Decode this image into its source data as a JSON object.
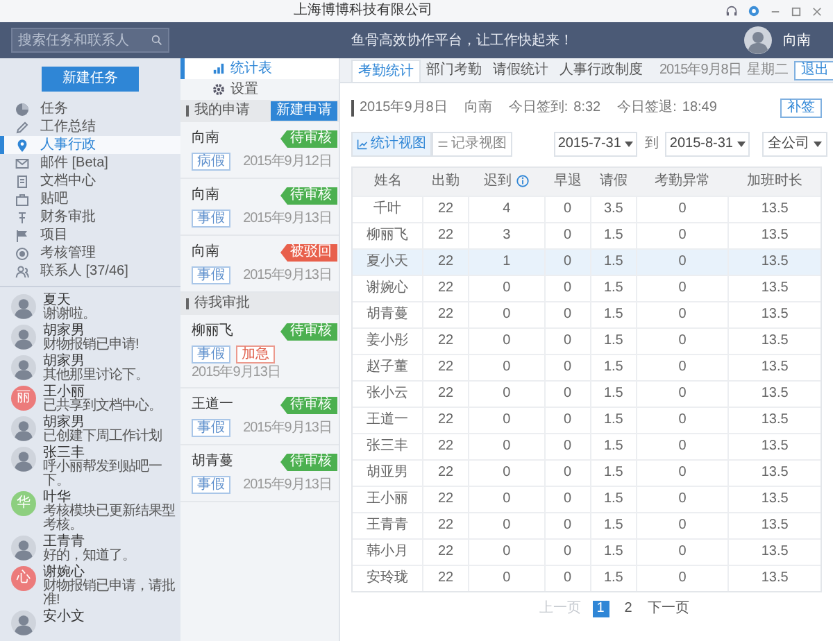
{
  "window": {
    "title": "上海博博科技有限公司"
  },
  "header": {
    "search": {
      "placeholder": "搜索任务和联系人"
    },
    "slogan": "鱼骨高效协作平台，让工作快起来！",
    "user": "向南"
  },
  "sidebar": {
    "new_task_button": "新建任务",
    "items": [
      {
        "label": "任务",
        "selected": false
      },
      {
        "label": "工作总结",
        "selected": false
      },
      {
        "label": "人事行政",
        "selected": true
      },
      {
        "label": "邮件 [Beta]",
        "selected": false
      },
      {
        "label": "文档中心",
        "selected": false
      },
      {
        "label": "贴吧",
        "selected": false
      },
      {
        "label": "财务审批",
        "selected": false
      },
      {
        "label": "项目",
        "selected": false
      },
      {
        "label": "考核管理",
        "selected": false
      },
      {
        "label": "联系人 [37/46]",
        "selected": false
      }
    ]
  },
  "contacts": [
    {
      "name": "夏天",
      "message": "谢谢啦。",
      "kind": "photo"
    },
    {
      "name": "胡家男",
      "message": "财物报销已申请!",
      "kind": "photo"
    },
    {
      "name": "胡家男",
      "message": "其他那里讨论下。",
      "kind": "photo"
    },
    {
      "name": "王小丽",
      "message": "已共享到文档中心。",
      "kind": "initial",
      "initial": "丽",
      "color": "#ec7b7b"
    },
    {
      "name": "胡家男",
      "message": "已创建下周工作计划",
      "kind": "photo"
    },
    {
      "name": "张三丰",
      "message": "呼小丽帮发到贴吧一下。",
      "kind": "photo"
    },
    {
      "name": "叶华",
      "message": "考核模块已更新结果型考核。",
      "kind": "initial",
      "initial": "华",
      "color": "#8dcf7f"
    },
    {
      "name": "王青青",
      "message": "好的，知道了。",
      "kind": "photo"
    },
    {
      "name": "谢婉心",
      "message": "财物报销已申请，请批准!",
      "kind": "initial",
      "initial": "心",
      "color": "#ec7b7b"
    },
    {
      "name": "安小文",
      "kind": "photo"
    }
  ],
  "module_tabs": [
    {
      "label": "统计表",
      "selected": true
    },
    {
      "label": "设置",
      "selected": false
    }
  ],
  "sections": [
    {
      "title": "我的申请",
      "button": "新建申请",
      "requests": [
        {
          "name": "向南",
          "tags": [
            {
              "label": "病假",
              "kind": "normal"
            }
          ],
          "date": "2015年9月12日",
          "status": {
            "label": "待审核",
            "kind": "pending"
          }
        },
        {
          "name": "向南",
          "tags": [
            {
              "label": "事假",
              "kind": "normal"
            }
          ],
          "date": "2015年9月13日",
          "status": {
            "label": "待审核",
            "kind": "pending"
          }
        },
        {
          "name": "向南",
          "tags": [
            {
              "label": "事假",
              "kind": "normal"
            }
          ],
          "date": "2015年9月13日",
          "status": {
            "label": "被驳回",
            "kind": "rejected"
          }
        }
      ]
    },
    {
      "title": "待我审批",
      "requests": [
        {
          "name": "柳丽飞",
          "tags": [
            {
              "label": "事假",
              "kind": "normal"
            },
            {
              "label": "加急",
              "kind": "urgent"
            }
          ],
          "date": "2015年9月13日",
          "status": {
            "label": "待审核",
            "kind": "pending"
          }
        },
        {
          "name": "王道一",
          "tags": [
            {
              "label": "事假",
              "kind": "normal"
            }
          ],
          "date": "2015年9月13日",
          "status": {
            "label": "待审核",
            "kind": "pending"
          }
        },
        {
          "name": "胡青蔓",
          "tags": [
            {
              "label": "事假",
              "kind": "normal"
            }
          ],
          "date": "2015年9月13日",
          "status": {
            "label": "待审核",
            "kind": "pending"
          }
        }
      ]
    }
  ],
  "tabs": [
    {
      "label": "考勤统计",
      "selected": true
    },
    {
      "label": "部门考勤",
      "selected": false
    },
    {
      "label": "请假统计",
      "selected": false
    },
    {
      "label": "人事行政制度",
      "selected": false
    }
  ],
  "today": {
    "date": "2015年9月8日",
    "weekday": "星期二"
  },
  "logout_button": "退出",
  "attendance": {
    "date": "2015年9月8日",
    "name": "向南",
    "checkin_label": "今日签到:",
    "checkin": "8:32",
    "checkout_label": "今日签退:",
    "checkout": "18:49",
    "button": "补签"
  },
  "view_toggle": [
    {
      "label": "统计视图",
      "selected": true
    },
    {
      "label": "记录视图",
      "selected": false
    }
  ],
  "range": {
    "from": "2015-7-31",
    "to_label": "到",
    "to": "2015-8-31"
  },
  "scope": "全公司",
  "table": {
    "columns": [
      {
        "label": "姓名",
        "info": false
      },
      {
        "label": "出勤",
        "info": false
      },
      {
        "label": "迟到",
        "info": true
      },
      {
        "label": "早退",
        "info": false
      },
      {
        "label": "请假",
        "info": false
      },
      {
        "label": "考勤异常",
        "info": false
      },
      {
        "label": "加班时长",
        "info": false
      }
    ],
    "rows": [
      {
        "cells": [
          "千叶",
          "22",
          "4",
          "0",
          "3.5",
          "0",
          "13.5"
        ],
        "selected": false
      },
      {
        "cells": [
          "柳丽飞",
          "22",
          "3",
          "0",
          "1.5",
          "0",
          "13.5"
        ],
        "selected": false
      },
      {
        "cells": [
          "夏小天",
          "22",
          "1",
          "0",
          "1.5",
          "0",
          "13.5"
        ],
        "selected": true
      },
      {
        "cells": [
          "谢婉心",
          "22",
          "0",
          "0",
          "1.5",
          "0",
          "13.5"
        ],
        "selected": false
      },
      {
        "cells": [
          "胡青蔓",
          "22",
          "0",
          "0",
          "1.5",
          "0",
          "13.5"
        ],
        "selected": false
      },
      {
        "cells": [
          "姜小彤",
          "22",
          "0",
          "0",
          "1.5",
          "0",
          "13.5"
        ],
        "selected": false
      },
      {
        "cells": [
          "赵子董",
          "22",
          "0",
          "0",
          "1.5",
          "0",
          "13.5"
        ],
        "selected": false
      },
      {
        "cells": [
          "张小云",
          "22",
          "0",
          "0",
          "1.5",
          "0",
          "13.5"
        ],
        "selected": false
      },
      {
        "cells": [
          "王道一",
          "22",
          "0",
          "0",
          "1.5",
          "0",
          "13.5"
        ],
        "selected": false
      },
      {
        "cells": [
          "张三丰",
          "22",
          "0",
          "0",
          "1.5",
          "0",
          "13.5"
        ],
        "selected": false
      },
      {
        "cells": [
          "胡亚男",
          "22",
          "0",
          "0",
          "1.5",
          "0",
          "13.5"
        ],
        "selected": false
      },
      {
        "cells": [
          "王小丽",
          "22",
          "0",
          "0",
          "1.5",
          "0",
          "13.5"
        ],
        "selected": false
      },
      {
        "cells": [
          "王青青",
          "22",
          "0",
          "0",
          "1.5",
          "0",
          "13.5"
        ],
        "selected": false
      },
      {
        "cells": [
          "韩小月",
          "22",
          "0",
          "0",
          "1.5",
          "0",
          "13.5"
        ],
        "selected": false
      },
      {
        "cells": [
          "安玲珑",
          "22",
          "0",
          "0",
          "1.5",
          "0",
          "13.5"
        ],
        "selected": false
      }
    ]
  },
  "pagination": {
    "prev": {
      "label": "上一页",
      "disabled": true
    },
    "pages": [
      {
        "label": "1",
        "selected": true
      },
      {
        "label": "2",
        "selected": false
      }
    ],
    "next": {
      "label": "下一页",
      "disabled": false
    }
  }
}
